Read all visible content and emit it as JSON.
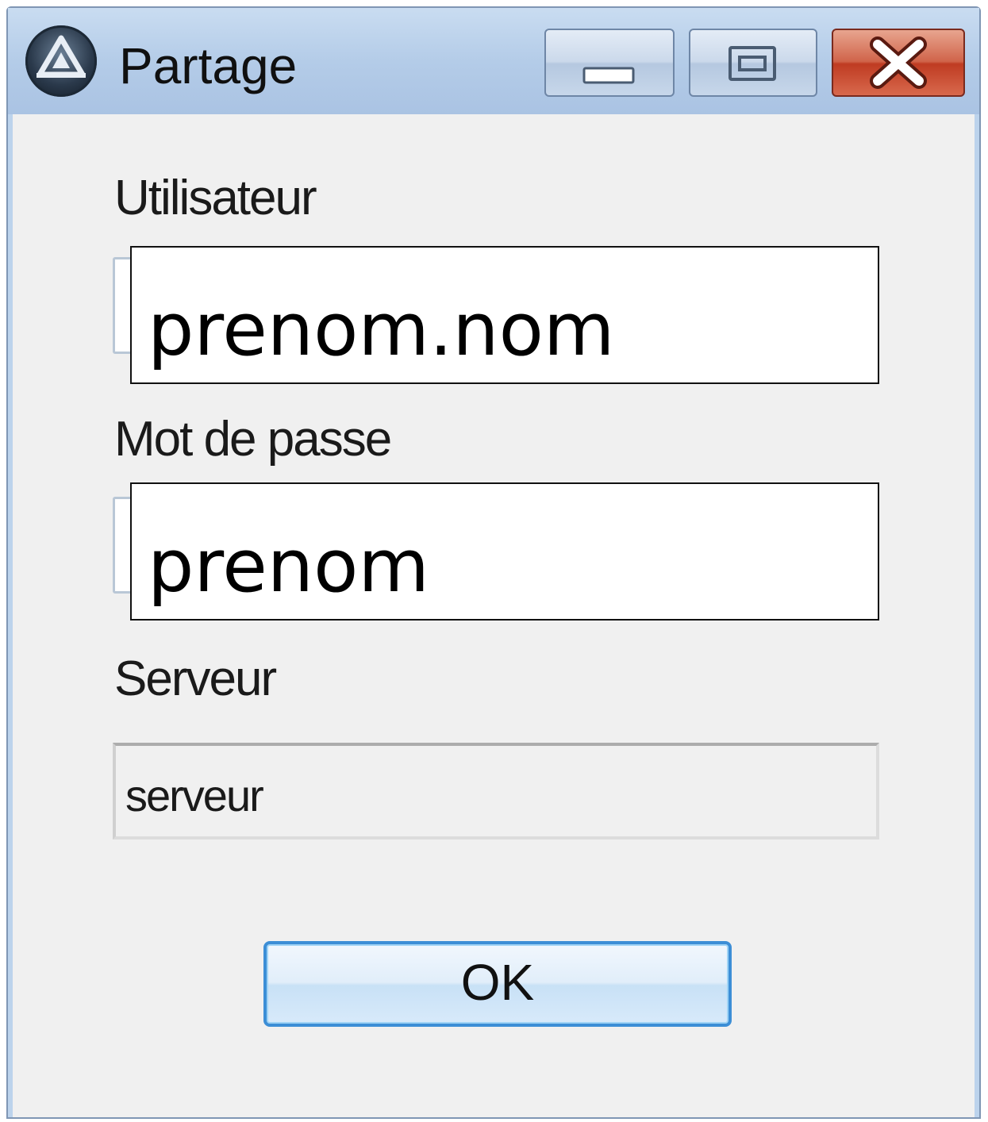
{
  "window": {
    "title": "Partage",
    "controls": {
      "minimize_icon": "minimize-icon",
      "maximize_icon": "maximize-icon",
      "close_icon": "close-icon"
    }
  },
  "form": {
    "user_label": "Utilisateur",
    "user_value": "prenom.nom",
    "password_label": "Mot de passe",
    "password_value": "prenom",
    "server_label": "Serveur",
    "server_value": "serveur"
  },
  "buttons": {
    "ok_label": "OK"
  },
  "colors": {
    "titlebar": "#b4cce8",
    "client_bg": "#f0f0f0",
    "close_red": "#c8442a",
    "ok_border": "#3c8ed6"
  }
}
